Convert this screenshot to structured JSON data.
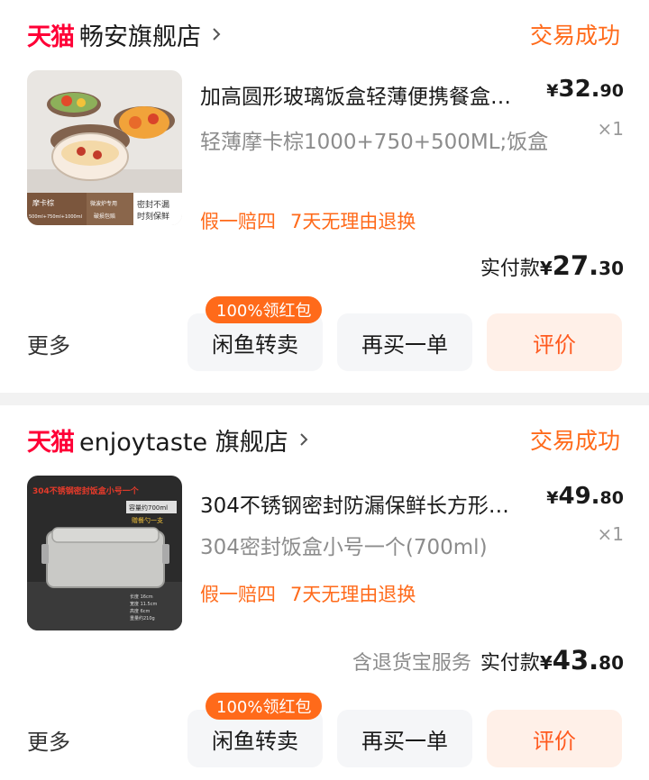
{
  "orders": [
    {
      "store_logo": "天猫",
      "store_name": "畅安旗舰店",
      "status": "交易成功",
      "thumb_texts": [
        "摩卡棕",
        "500ml+750ml+1000ml",
        "微波炉专用",
        "破损包赔",
        "密封不漏",
        "时刻保鲜"
      ],
      "title": "加高圆形玻璃饭盒轻薄便携餐盒…",
      "price_currency": "¥",
      "price_int": "32.",
      "price_dec": "90",
      "qty": "×1",
      "sku": "轻薄摩卡棕1000+750+500ML;饭盒",
      "tags": [
        "假一赔四",
        "7天无理由退换"
      ],
      "insurance": "",
      "paid_label": "实付款",
      "paid_currency": "¥",
      "paid_int": "27.",
      "paid_dec": "30",
      "more": "更多",
      "badge": "100%领红包",
      "btn_resell": "闲鱼转卖",
      "btn_rebuy": "再买一单",
      "btn_review": "评价"
    },
    {
      "store_logo": "天猫",
      "store_name": "enjoytaste 旗舰店",
      "status": "交易成功",
      "thumb_texts": [
        "304不锈钢密封饭盒小号一个",
        "容量约700ml",
        "赠餐勺一支",
        "长度 16cm",
        "宽度 11.5cm",
        "高度 6cm",
        "重量约210g"
      ],
      "title": "304不锈钢密封防漏保鲜长方形…",
      "price_currency": "¥",
      "price_int": "49.",
      "price_dec": "80",
      "qty": "×1",
      "sku": "304密封饭盒小号一个(700ml)",
      "tags": [
        "假一赔四",
        "7天无理由退换"
      ],
      "insurance": "含退货宝服务",
      "paid_label": "实付款",
      "paid_currency": "¥",
      "paid_int": "43.",
      "paid_dec": "80",
      "more": "更多",
      "badge": "100%领红包",
      "btn_resell": "闲鱼转卖",
      "btn_rebuy": "再买一单",
      "btn_review": "评价"
    }
  ],
  "colors": {
    "accent": "#ff6a1a",
    "tmall_red": "#ff0036",
    "review_bg": "#fff0e8",
    "button_bg": "#f5f6f8"
  },
  "icons": {
    "store_chevron": "chevron-right-icon"
  }
}
